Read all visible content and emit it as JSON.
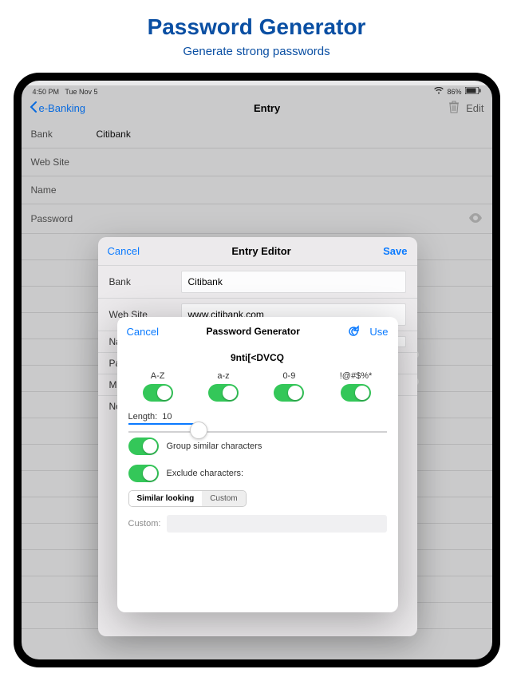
{
  "promo": {
    "title": "Password Generator",
    "subtitle": "Generate strong passwords"
  },
  "status": {
    "time": "4:50 PM",
    "date": "Tue Nov 5",
    "battery": "86%"
  },
  "nav": {
    "back": "e-Banking",
    "title": "Entry",
    "edit": "Edit"
  },
  "entry": {
    "rows": [
      {
        "label": "Bank",
        "value": "Citibank"
      },
      {
        "label": "Web Site",
        "value": ""
      },
      {
        "label": "Name",
        "value": ""
      },
      {
        "label": "Password",
        "value": ""
      }
    ]
  },
  "editor": {
    "cancel": "Cancel",
    "title": "Entry Editor",
    "save": "Save",
    "rows": {
      "bank": {
        "label": "Bank",
        "value": "Citibank"
      },
      "website": {
        "label": "Web Site",
        "value": "www.citibank.com"
      },
      "name": {
        "label": "Name",
        "value": ""
      },
      "password": {
        "label": "Pas",
        "value": ""
      },
      "more": {
        "label": "Mo",
        "value": ""
      },
      "notes": {
        "label": "No",
        "value": ""
      }
    }
  },
  "pgen": {
    "cancel": "Cancel",
    "title": "Password Generator",
    "use": "Use",
    "generated": "9nti[<DVCQ",
    "toggles": {
      "upper": {
        "label": "A-Z",
        "on": true
      },
      "lower": {
        "label": "a-z",
        "on": true
      },
      "digits": {
        "label": "0-9",
        "on": true
      },
      "symbols": {
        "label": "!@#$%*",
        "on": true
      }
    },
    "length": {
      "label": "Length:",
      "value": "10"
    },
    "group": {
      "label": "Group similar characters",
      "on": true
    },
    "exclude": {
      "label": "Exclude characters:",
      "on": true
    },
    "segments": {
      "similar": "Similar looking",
      "custom": "Custom"
    },
    "custom_label": "Custom:"
  }
}
